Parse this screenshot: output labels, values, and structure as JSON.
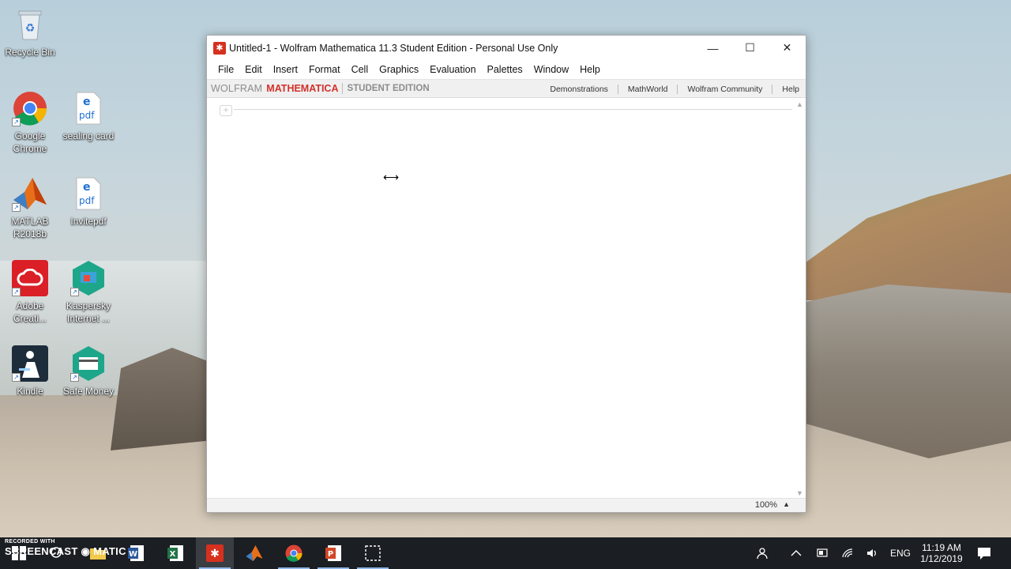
{
  "desktop": {
    "icons": [
      {
        "label": "Recycle Bin"
      },
      {
        "label": "Google Chrome"
      },
      {
        "label": "sealing card"
      },
      {
        "label": "MATLAB R2018b"
      },
      {
        "label": "Invitepdf"
      },
      {
        "label": "Adobe Creati..."
      },
      {
        "label": "Kaspersky Internet ..."
      },
      {
        "label": "Kindle"
      },
      {
        "label": "Safe Money"
      }
    ]
  },
  "window": {
    "title": "Untitled-1 - Wolfram Mathematica 11.3 Student Edition - Personal Use Only",
    "controls": {
      "minimize": "—",
      "maximize": "☐",
      "close": "✕"
    },
    "menu": [
      "File",
      "Edit",
      "Insert",
      "Format",
      "Cell",
      "Graphics",
      "Evaluation",
      "Palettes",
      "Window",
      "Help"
    ],
    "brand": {
      "wolfram": "WOLFRAM",
      "mathematica": "MATHEMATICA",
      "edition": "STUDENT EDITION"
    },
    "links": [
      "Demonstrations",
      "MathWorld",
      "Wolfram Community",
      "Help"
    ],
    "status": {
      "zoom": "100%"
    }
  },
  "taskbar": {
    "watermark": {
      "line1": "RECORDED WITH",
      "line2": "SCREENCAST",
      "line3": "MATIC"
    },
    "tray": {
      "language": "ENG",
      "time": "11:19 AM",
      "date": "1/12/2019"
    }
  },
  "colors": {
    "accent": "#d2312a",
    "taskbar": "#1b1e22"
  }
}
